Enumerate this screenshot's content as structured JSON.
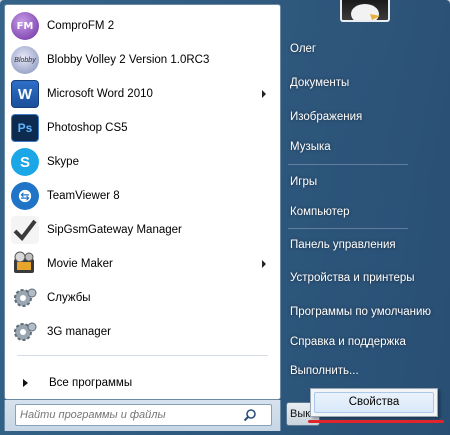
{
  "programs": [
    {
      "label": "ComproFM 2",
      "icon": "comprofm-icon",
      "submenu": false
    },
    {
      "label": "Blobby Volley 2 Version 1.0RC3",
      "icon": "blobby-volley-icon",
      "submenu": false
    },
    {
      "label": "Microsoft Word 2010",
      "icon": "word-icon",
      "submenu": true
    },
    {
      "label": "Photoshop CS5",
      "icon": "photoshop-icon",
      "submenu": false
    },
    {
      "label": "Skype",
      "icon": "skype-icon",
      "submenu": false
    },
    {
      "label": "TeamViewer 8",
      "icon": "teamviewer-icon",
      "submenu": false
    },
    {
      "label": "SipGsmGateway Manager",
      "icon": "checkmark-icon",
      "submenu": false
    },
    {
      "label": "Movie Maker",
      "icon": "movie-maker-icon",
      "submenu": true
    },
    {
      "label": "Службы",
      "icon": "services-gear-icon",
      "submenu": false
    },
    {
      "label": "3G manager",
      "icon": "3g-manager-gear-icon",
      "submenu": false
    }
  ],
  "all_programs_label": "Все программы",
  "search": {
    "placeholder": "Найти программы и файлы"
  },
  "right_items": [
    "Олег",
    "Документы",
    "Изображения",
    "Музыка",
    "Игры",
    "Компьютер",
    "Панель управления",
    "Устройства и принтеры",
    "Программы по умолчанию",
    "Справка и поддержка",
    "Выполнить..."
  ],
  "shutdown_label": "Вык",
  "context_menu": {
    "item": "Свойства"
  },
  "colors": {
    "highlight_underline": "#e0262b",
    "accent": "#2a5f8c"
  }
}
